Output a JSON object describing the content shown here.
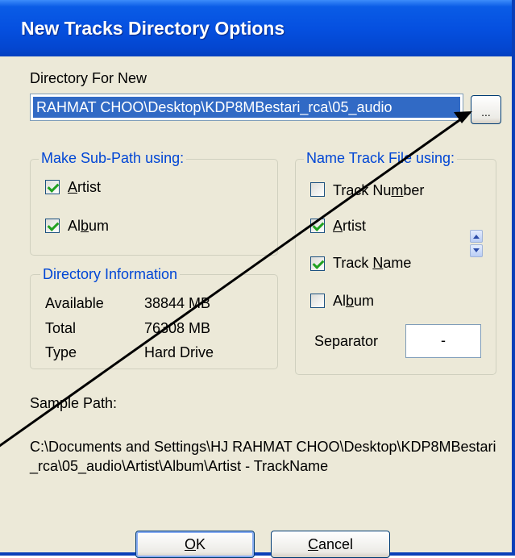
{
  "window": {
    "title": "New Tracks Directory Options"
  },
  "directory": {
    "label": "Directory For New",
    "value": "RAHMAT CHOO\\Desktop\\KDP8MBestari_rca\\05_audio",
    "browse_label": "..."
  },
  "subpath": {
    "legend": "Make Sub-Path using:",
    "items": [
      {
        "acc": "A",
        "rest": "rtist",
        "checked": true
      },
      {
        "pre": "Al",
        "acc": "b",
        "rest": "um",
        "checked": true
      }
    ]
  },
  "info": {
    "legend": "Directory Information",
    "rows": [
      {
        "label": "Available",
        "value": "38844 MB"
      },
      {
        "label": "Total",
        "value": "76308 MB"
      },
      {
        "label": "Type",
        "value": "Hard Drive"
      }
    ]
  },
  "namefile": {
    "legend": "Name Track File using:",
    "items": [
      {
        "pre": "Track Nu",
        "acc": "m",
        "rest": "ber",
        "checked": false
      },
      {
        "pre": "",
        "acc": "A",
        "rest": "rtist",
        "checked": true
      },
      {
        "pre": "Track ",
        "acc": "N",
        "rest": "ame",
        "checked": true
      },
      {
        "pre": "Al",
        "acc": "b",
        "rest": "um",
        "checked": false
      }
    ],
    "separator_label": "Separator",
    "separator_value": "-"
  },
  "sample": {
    "label": "Sample Path:",
    "path": "C:\\Documents and Settings\\HJ RAHMAT CHOO\\Desktop\\KDP8MBestari_rca\\05_audio\\Artist\\Album\\Artist - TrackName"
  },
  "buttons": {
    "ok": {
      "acc": "O",
      "rest": "K"
    },
    "cancel": {
      "acc": "C",
      "rest": "ancel"
    }
  },
  "colors": {
    "title_bar": "#0550e0",
    "group_legend": "#0046d5",
    "selection": "#316ac5",
    "check_mark": "#21a121"
  }
}
